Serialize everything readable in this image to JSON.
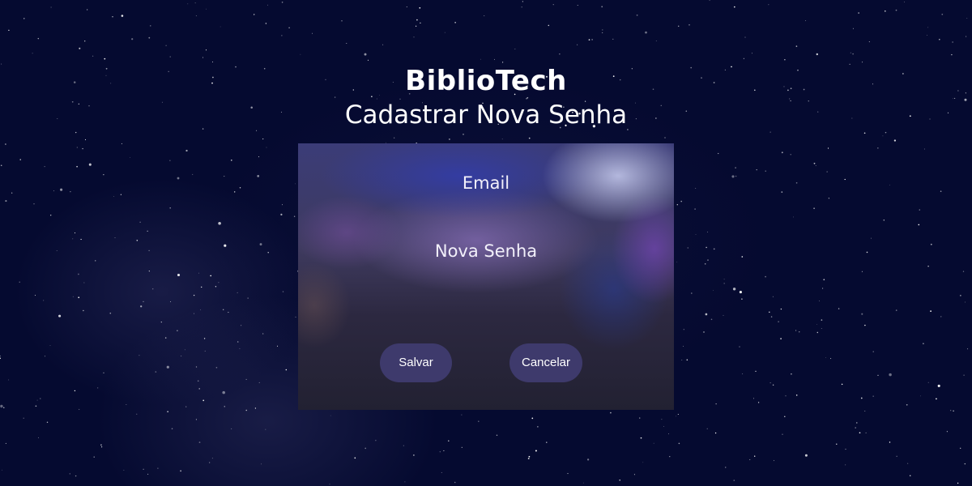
{
  "header": {
    "app_title": "BiblioTech",
    "subtitle": "Cadastrar Nova Senha"
  },
  "form": {
    "email_label": "Email",
    "password_label": "Nova Senha",
    "save_button": "Salvar",
    "cancel_button": "Cancelar"
  },
  "colors": {
    "background": "#050a30",
    "button": "#3e3a6c",
    "text": "#ffffff"
  }
}
